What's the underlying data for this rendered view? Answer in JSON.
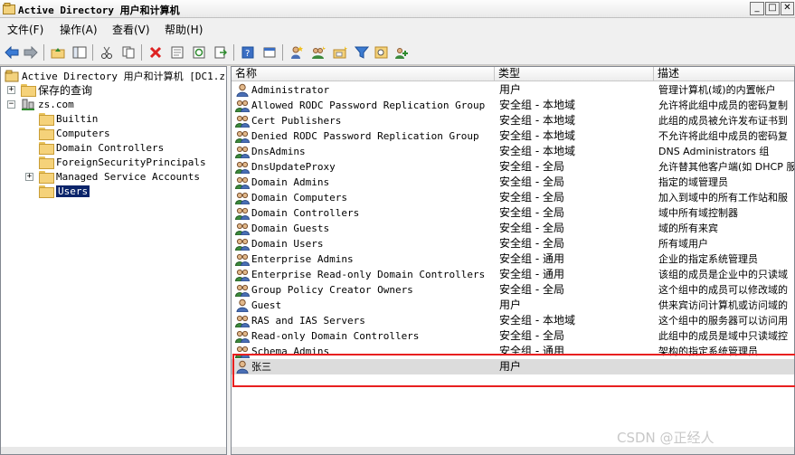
{
  "window": {
    "title": "Active Directory 用户和计算机"
  },
  "menu": [
    "文件(F)",
    "操作(A)",
    "查看(V)",
    "帮助(H)"
  ],
  "toolbar": [
    "back-icon",
    "forward-icon",
    "up-folder-icon",
    "show-tree-icon",
    "cut-icon",
    "copy-icon",
    "delete-icon",
    "properties-icon",
    "refresh-icon",
    "export-list-icon",
    "help-icon",
    "console-icon",
    "new-user-icon",
    "new-group-icon",
    "new-ou-icon",
    "filter-icon",
    "find-icon",
    "add-to-group-icon"
  ],
  "tree": {
    "root": "Active Directory 用户和计算机 [DC1.zs",
    "saved_queries": "保存的查询",
    "domain": "zs.com",
    "children": [
      "Builtin",
      "Computers",
      "Domain Controllers",
      "ForeignSecurityPrincipals",
      "Managed Service Accounts",
      "Users"
    ]
  },
  "columns": {
    "name": "名称",
    "type": "类型",
    "desc": "描述"
  },
  "rows": [
    {
      "name": "Administrator",
      "type": "用户",
      "desc": "管理计算机(域)的内置帐户",
      "icon": "user"
    },
    {
      "name": "Allowed RODC Password Replication Group",
      "type": "安全组 - 本地域",
      "desc": "允许将此组中成员的密码复制",
      "icon": "group"
    },
    {
      "name": "Cert Publishers",
      "type": "安全组 - 本地域",
      "desc": "此组的成员被允许发布证书到",
      "icon": "group"
    },
    {
      "name": "Denied RODC Password Replication Group",
      "type": "安全组 - 本地域",
      "desc": "不允许将此组中成员的密码复",
      "icon": "group"
    },
    {
      "name": "DnsAdmins",
      "type": "安全组 - 本地域",
      "desc": "DNS Administrators 组",
      "icon": "group"
    },
    {
      "name": "DnsUpdateProxy",
      "type": "安全组 - 全局",
      "desc": "允许替其他客户端(如 DHCP 服",
      "icon": "group"
    },
    {
      "name": "Domain Admins",
      "type": "安全组 - 全局",
      "desc": "指定的域管理员",
      "icon": "group"
    },
    {
      "name": "Domain Computers",
      "type": "安全组 - 全局",
      "desc": "加入到域中的所有工作站和服",
      "icon": "group"
    },
    {
      "name": "Domain Controllers",
      "type": "安全组 - 全局",
      "desc": "域中所有域控制器",
      "icon": "group"
    },
    {
      "name": "Domain Guests",
      "type": "安全组 - 全局",
      "desc": "域的所有来宾",
      "icon": "group"
    },
    {
      "name": "Domain Users",
      "type": "安全组 - 全局",
      "desc": "所有域用户",
      "icon": "group"
    },
    {
      "name": "Enterprise Admins",
      "type": "安全组 - 通用",
      "desc": "企业的指定系统管理员",
      "icon": "group"
    },
    {
      "name": "Enterprise Read-only Domain Controllers",
      "type": "安全组 - 通用",
      "desc": "该组的成员是企业中的只读域",
      "icon": "group"
    },
    {
      "name": "Group Policy Creator Owners",
      "type": "安全组 - 全局",
      "desc": "这个组中的成员可以修改域的",
      "icon": "group"
    },
    {
      "name": "Guest",
      "type": "用户",
      "desc": "供来宾访问计算机或访问域的",
      "icon": "user"
    },
    {
      "name": "RAS and IAS Servers",
      "type": "安全组 - 本地域",
      "desc": "这个组中的服务器可以访问用",
      "icon": "group"
    },
    {
      "name": "Read-only Domain Controllers",
      "type": "安全组 - 全局",
      "desc": "此组中的成员是域中只读域控",
      "icon": "group"
    },
    {
      "name": "Schema Admins",
      "type": "安全组 - 通用",
      "desc": "架构的指定系统管理员",
      "icon": "group"
    },
    {
      "name": "张三",
      "type": "用户",
      "desc": "",
      "icon": "user"
    }
  ],
  "watermark": "CSDN @正经人",
  "colors": {
    "selection": "#0a246a",
    "highlight_box": "#e81f1f"
  }
}
